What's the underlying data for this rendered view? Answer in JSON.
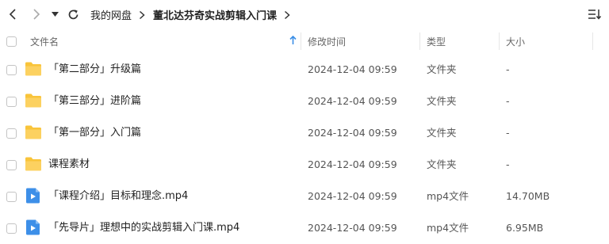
{
  "nav": {
    "breadcrumb": [
      "我的网盘",
      "董北达芬奇实战剪辑入门课"
    ],
    "back_icon": "chevron-left-icon",
    "forward_icon": "chevron-right-icon",
    "history_icon": "caret-down-icon",
    "refresh_icon": "refresh-icon",
    "sort_icon": "sort-menu-icon"
  },
  "columns": {
    "name": "文件名",
    "modified": "修改时间",
    "type": "类型",
    "size": "大小",
    "sort_icon": "arrow-up-icon"
  },
  "files": [
    {
      "name": "「第二部分」升级篇",
      "modified": "2024-12-04 09:59",
      "type": "文件夹",
      "size": "-",
      "icon": "folder-icon"
    },
    {
      "name": "「第三部分」进阶篇",
      "modified": "2024-12-04 09:59",
      "type": "文件夹",
      "size": "-",
      "icon": "folder-icon"
    },
    {
      "name": "「第一部分」入门篇",
      "modified": "2024-12-04 09:59",
      "type": "文件夹",
      "size": "-",
      "icon": "folder-icon"
    },
    {
      "name": "课程素材",
      "modified": "2024-12-04 09:59",
      "type": "文件夹",
      "size": "-",
      "icon": "folder-icon"
    },
    {
      "name": "「课程介绍」目标和理念.mp4",
      "modified": "2024-12-04 09:59",
      "type": "mp4文件",
      "size": "14.70MB",
      "icon": "video-file-icon"
    },
    {
      "name": "「先导片」理想中的实战剪辑入门课.mp4",
      "modified": "2024-12-04 09:59",
      "type": "mp4文件",
      "size": "6.95MB",
      "icon": "video-file-icon"
    }
  ],
  "colors": {
    "folder": "#f9c43a",
    "video": "#3d8fe8",
    "accent": "#3a8ee6"
  }
}
